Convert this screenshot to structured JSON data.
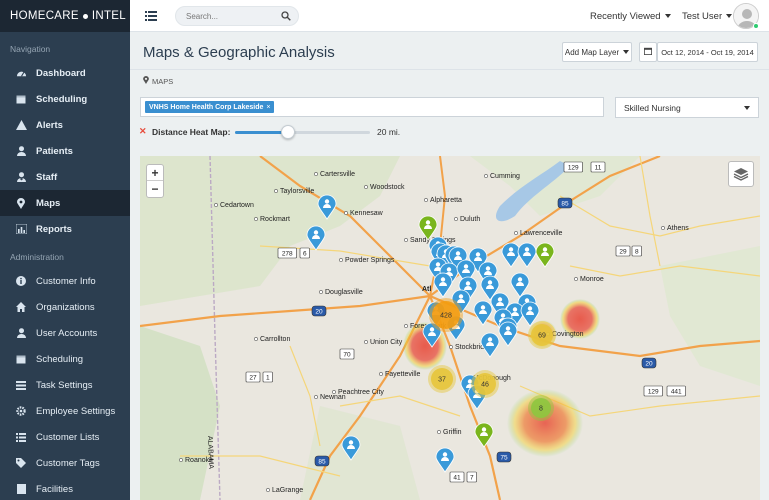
{
  "brand": {
    "left": "HOMECARE",
    "right": "INTEL"
  },
  "sidebar": {
    "nav_heading": "Navigation",
    "nav_items": [
      {
        "label": "Dashboard",
        "icon": "dashboard-icon"
      },
      {
        "label": "Scheduling",
        "icon": "calendar-icon"
      },
      {
        "label": "Alerts",
        "icon": "warning-icon"
      },
      {
        "label": "Patients",
        "icon": "user-icon"
      },
      {
        "label": "Staff",
        "icon": "staff-icon"
      },
      {
        "label": "Maps",
        "icon": "map-marker-icon",
        "active": true
      },
      {
        "label": "Reports",
        "icon": "bar-chart-icon"
      }
    ],
    "admin_heading": "Administration",
    "admin_items": [
      {
        "label": "Customer Info",
        "icon": "info-icon"
      },
      {
        "label": "Organizations",
        "icon": "home-icon"
      },
      {
        "label": "User Accounts",
        "icon": "user-icon"
      },
      {
        "label": "Scheduling",
        "icon": "calendar-icon"
      },
      {
        "label": "Task Settings",
        "icon": "tasks-icon"
      },
      {
        "label": "Employee Settings",
        "icon": "gear-icon"
      },
      {
        "label": "Customer Lists",
        "icon": "list-icon"
      },
      {
        "label": "Customer Tags",
        "icon": "tag-icon"
      },
      {
        "label": "Facilities",
        "icon": "building-icon"
      }
    ]
  },
  "topbar": {
    "search_placeholder": "Search...",
    "recently_viewed": "Recently Viewed",
    "user_name": "Test User"
  },
  "page": {
    "title": "Maps & Geographic Analysis",
    "add_layer": "Add Map Layer",
    "date_range": "Oct 12, 2014 - Oct 19, 2014",
    "breadcrumb": "MAPS"
  },
  "filters": {
    "tag": "VNHS Home Health Corp Lakeside",
    "tag_remove": "×",
    "service": "Skilled Nursing",
    "heat_label": "Distance Heat Map:",
    "distance": "20 mi.",
    "distance_fraction": 0.39
  },
  "map": {
    "zoom_in": "+",
    "zoom_out": "−",
    "cities": [
      "Cartersville",
      "Taylorsville",
      "Cedartown",
      "Rockmart",
      "Woodstock",
      "Kennesaw",
      "Alpharetta",
      "Cumming",
      "Duluth",
      "Sandy Springs",
      "Lawrenceville",
      "Athens",
      "Powder Springs",
      "Douglasville",
      "Monroe",
      "Carrollton",
      "Forest Park",
      "Union City",
      "Stockbridge",
      "Covington",
      "Fayetteville",
      "McDonough",
      "Newnan",
      "Peachtree City",
      "Griffin",
      "Roanoke",
      "LaGrange",
      "ALABAMA",
      "Atl"
    ],
    "road_shields": [
      "129",
      "11",
      "85",
      "278",
      "6",
      "29",
      "8",
      "20",
      "70",
      "27",
      "1",
      "20",
      "129",
      "441",
      "85",
      "75",
      "41",
      "7"
    ],
    "clusters": [
      "428",
      "69",
      "37",
      "46",
      "8"
    ],
    "colors": {
      "marker_blue": "#3a9ad9",
      "marker_green": "#7ab51d",
      "cluster_orange": "#f39c12",
      "cluster_yellow": "#e7c53a",
      "heat_red": "#e74c3c"
    }
  }
}
